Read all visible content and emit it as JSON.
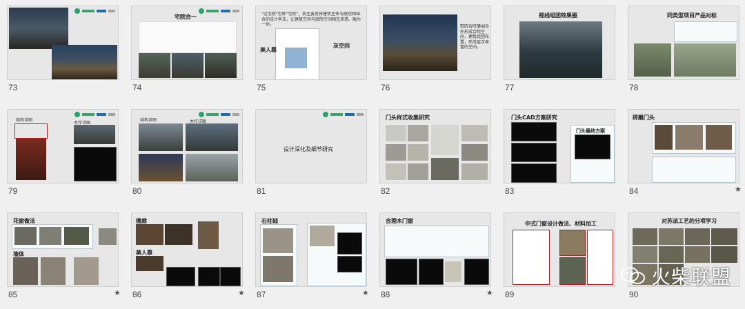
{
  "slides": [
    {
      "num": "73",
      "star": ""
    },
    {
      "num": "74",
      "title": "宅院合一",
      "star": ""
    },
    {
      "num": "75",
      "callout_left": "美人靠",
      "callout_right": "灰空间",
      "text": "\"过宅院\"也称\"宅院\"，其主要是将建筑主体与庭院相结合的设计手法，让建筑空间与庭院空间相互渗透、融为一体。",
      "star": ""
    },
    {
      "num": "76",
      "text": "取四合院落围合外形成合院空间，建筑组团布置，形成层次丰富的空间。",
      "star": ""
    },
    {
      "num": "77",
      "title": "视线组团效果图",
      "star": ""
    },
    {
      "num": "78",
      "title": "同类型项目产品对标",
      "star": ""
    },
    {
      "num": "79",
      "label_a": "结构详图",
      "label_b": "木作详图",
      "star": ""
    },
    {
      "num": "80",
      "label_a": "结构详图",
      "label_b": "木作详图",
      "star": ""
    },
    {
      "num": "81",
      "title": "设计深化及细节研究",
      "star": ""
    },
    {
      "num": "82",
      "title": "门头样式收集研究",
      "star": ""
    },
    {
      "num": "83",
      "title": "门头CAD方案研究",
      "title_b": "门头最终方案",
      "star": ""
    },
    {
      "num": "84",
      "title": "砖雕门头",
      "star": "★"
    },
    {
      "num": "85",
      "title": "花窗做法",
      "label_b": "墙体",
      "star": "★"
    },
    {
      "num": "86",
      "title": "檐廊",
      "label_b": "美人靠",
      "star": "★"
    },
    {
      "num": "87",
      "title": "石柱础",
      "star": "★"
    },
    {
      "num": "88",
      "title": "合理木门窗",
      "star": "★"
    },
    {
      "num": "89",
      "title": "中式门窗设计做法、材料加工",
      "star": ""
    },
    {
      "num": "90",
      "title": "对苏派工艺的分项学习",
      "star": ""
    }
  ],
  "watermark": {
    "text": "火柴联盟",
    "icon": "wechat-icon"
  },
  "colors": {
    "accent_green": "#2aa36b",
    "brand_blue": "#1f6fb0",
    "cad_bg": "#0a0a0a",
    "red": "#b0201c"
  }
}
